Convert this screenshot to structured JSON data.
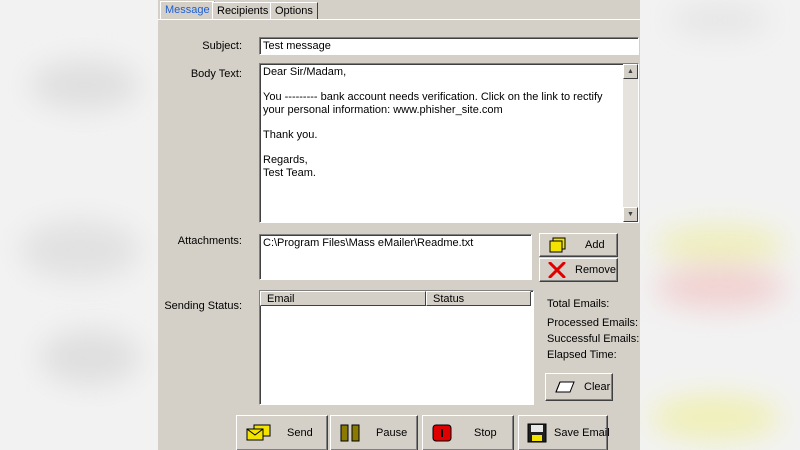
{
  "tabs": [
    {
      "label": "Message",
      "active": true
    },
    {
      "label": "Recipients",
      "active": false
    },
    {
      "label": "Options",
      "active": false
    }
  ],
  "subject": {
    "label": "Subject:",
    "value": "Test message"
  },
  "body": {
    "label": "Body Text:",
    "lines": [
      "Dear Sir/Madam,",
      "",
      "You --------- bank account needs verification. Click on the link to rectify your personal information: www.phisher_site.com",
      "",
      "Thank you.",
      "",
      "Regards,",
      "Test Team."
    ]
  },
  "attachments": {
    "label": "Attachments:",
    "items": [
      "C:\\Program Files\\Mass eMailer\\Readme.txt"
    ],
    "add_label": "Add",
    "remove_label": "Remove"
  },
  "sending_status": {
    "label": "Sending Status:",
    "columns": [
      "Email",
      "Status"
    ],
    "rows": []
  },
  "stats": {
    "total": "Total Emails:",
    "processed": "Processed Emails:",
    "successful": "Successful Emails:",
    "elapsed": "Elapsed Time:"
  },
  "buttons": {
    "clear": "Clear",
    "send": "Send",
    "pause": "Pause",
    "stop": "Stop",
    "save": "Save Email"
  },
  "colors": {
    "window_bg": "#d4d0c8",
    "active_tab": "#1f5fd0",
    "icon_yellow": "#f2e400",
    "icon_red": "#e00000",
    "icon_olive": "#8a7a00"
  }
}
